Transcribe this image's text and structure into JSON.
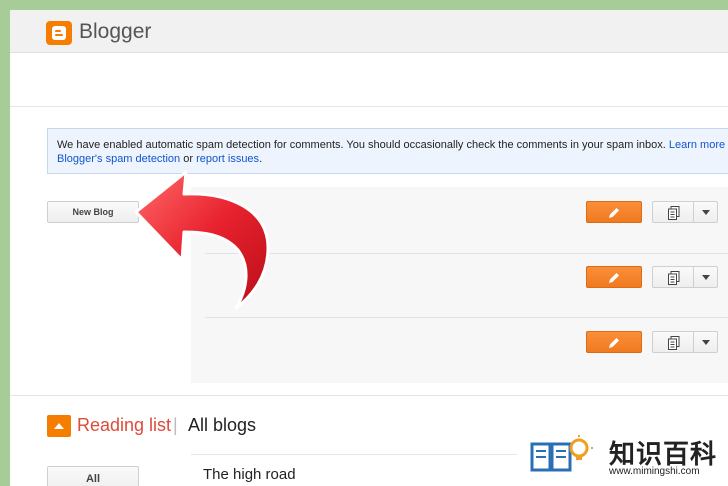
{
  "app": {
    "title": "Blogger",
    "logo_icon": "blogger-logo-icon",
    "brand_color": "#f57d00"
  },
  "notice": {
    "text": "We have enabled automatic spam detection for comments. You should occasionally check the comments in your spam inbox. ",
    "learn_more_link": "Learn more a",
    "spam_detection_link": "Blogger's spam detection",
    "mid_text": " or ",
    "report_link": "report issues",
    "end_text": "."
  },
  "toolbar": {
    "new_blog_label": "New Blog"
  },
  "blog_rows": [
    {
      "edit_icon": "pencil-icon",
      "posts_icon": "documents-icon",
      "menu_icon": "chevron-down-icon"
    },
    {
      "edit_icon": "pencil-icon",
      "posts_icon": "documents-icon",
      "menu_icon": "chevron-down-icon"
    },
    {
      "edit_icon": "pencil-icon",
      "posts_icon": "documents-icon",
      "menu_icon": "chevron-down-icon"
    }
  ],
  "reading_list": {
    "title": "Reading list",
    "separator": "|",
    "filter_label": "All blogs",
    "all_button_label": "All",
    "first_post_title": "The high road"
  },
  "overlay": {
    "arrow_color": "#e8222e"
  },
  "watermark": {
    "text": "知识百科",
    "url": "www.mimingshi.com"
  }
}
